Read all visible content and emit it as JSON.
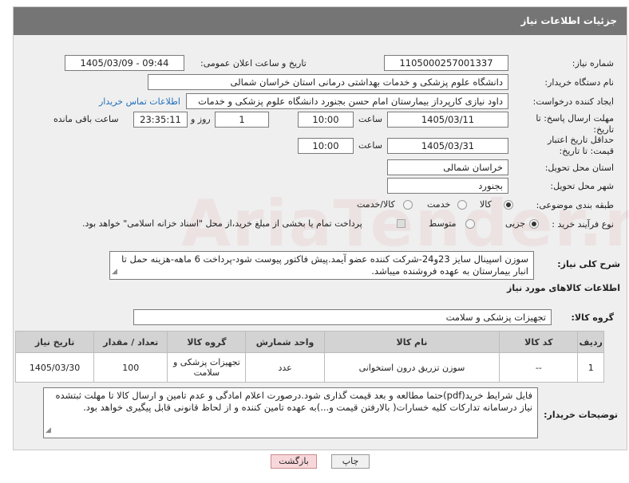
{
  "header": {
    "title": "جزئیات اطلاعات نیاز"
  },
  "labels": {
    "need_number": "شماره نیاز:",
    "announce_datetime": "تاریخ و ساعت اعلان عمومی:",
    "buyer_org": "نام دستگاه خریدار:",
    "requester": "ایجاد کننده درخواست:",
    "reply_deadline": "مهلت ارسال پاسخ: تا تاریخ:",
    "price_validity": "حداقل تاریخ اعتبار قیمت: تا تاریخ:",
    "time": "ساعت",
    "days_and": "روز و",
    "time_remaining": "ساعت باقی مانده",
    "province": "استان محل تحویل:",
    "city": "شهر محل تحویل:",
    "category": "طبقه بندی موضوعی:",
    "process_type": "نوع فرآیند خرید :",
    "general_desc": "شرح کلی نیاز:",
    "goods_info": "اطلاعات کالاهای مورد نیاز",
    "goods_group": "گروه کالا:",
    "buyer_notes": "توضیحات خریدار:"
  },
  "fields": {
    "need_number": "1105000257001337",
    "announce_datetime": "1405/03/09 - 09:44",
    "buyer_org": "دانشگاه علوم پزشکی و خدمات بهداشتی درمانی استان خراسان شمالی",
    "requester": "داود نیازی کارپرداز بیمارستان امام حسن بجنورد دانشگاه علوم پزشکی و خدمات",
    "contact_link": "اطلاعات تماس خریدار",
    "reply_date": "1405/03/11",
    "reply_time": "10:00",
    "days": "1",
    "remaining": "23:35:11",
    "validity_date": "1405/03/31",
    "validity_time": "10:00",
    "province": "خراسان شمالی",
    "city": "بجنورد",
    "category_options": [
      "کالا",
      "خدمت",
      "کالا/خدمت"
    ],
    "process_options": [
      "جزیی",
      "متوسط"
    ],
    "payment_note": "پرداخت تمام یا بخشی از مبلغ خرید،از محل \"اسناد خزانه اسلامی\" خواهد بود.",
    "general_desc": "سوزن اسپینال سایز 23و24-شرکت کننده عضو آیمد.پیش فاکتور پیوست  شود-پرداخت 6 ماهه-هزینه حمل تا انبار بیمارستان به عهده فروشنده میباشد.",
    "goods_group": "تجهیزات پزشکی و سلامت",
    "buyer_notes": "فایل شرایط خرید(pdf)حتما مطالعه و بعد قیمت گذاری شود.درصورت اعلام امادگی و عدم تامین و ارسال کالا تا مهلت ثبتشده نیاز درسامانه تدارکات کلیه خسارات( بالارفتن قیمت و...)به عهده تامین کننده و از لحاظ قانونی قابل پیگیری خواهد بود."
  },
  "table": {
    "headers": [
      "ردیف",
      "کد کالا",
      "نام کالا",
      "واحد شمارش",
      "گروه کالا",
      "تعداد / مقدار",
      "تاریخ نیاز"
    ],
    "rows": [
      {
        "row": "1",
        "code": "--",
        "name": "سوزن تزریق درون استخوانی",
        "unit": "عدد",
        "group": "تجهیزات پزشکی و سلامت",
        "qty": "100",
        "date": "1405/03/30"
      }
    ]
  },
  "buttons": {
    "print": "چاپ",
    "back": "بازگشت"
  },
  "watermark": "AriaTender.neT",
  "colors": {
    "header_bg": "#757575",
    "link": "#1f6fbd",
    "back_btn_bg": "#f8d7da"
  }
}
